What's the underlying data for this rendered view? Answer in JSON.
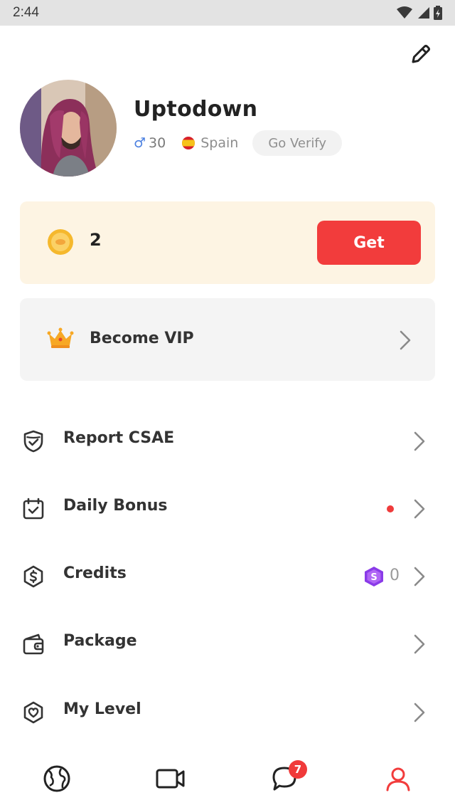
{
  "status_bar": {
    "time": "2:44"
  },
  "profile": {
    "name": "Uptodown",
    "gender_symbol": "♂",
    "age": "30",
    "country": "Spain",
    "verify_label": "Go Verify"
  },
  "coins": {
    "count": "2",
    "get_label": "Get"
  },
  "vip": {
    "label": "Become VIP"
  },
  "menu": [
    {
      "label": "Report CSAE",
      "icon": "shield-check-icon"
    },
    {
      "label": "Daily Bonus",
      "icon": "calendar-check-icon",
      "has_dot": true
    },
    {
      "label": "Credits",
      "icon": "dollar-shield-icon",
      "value": "0"
    },
    {
      "label": "Package",
      "icon": "wallet-icon"
    },
    {
      "label": "My Level",
      "icon": "heart-shield-icon"
    }
  ],
  "tabbar": {
    "items": [
      "globe-icon",
      "video-camera-icon",
      "chat-icon",
      "profile-icon"
    ],
    "chat_badge": "7",
    "active_index": 3
  },
  "colors": {
    "accent": "#f23c3c",
    "coin_card_bg": "#fdf4e3",
    "vip_card_bg": "#f4f4f4",
    "gender_blue": "#4a7fe0",
    "credit_purple": "#8a3be8"
  }
}
